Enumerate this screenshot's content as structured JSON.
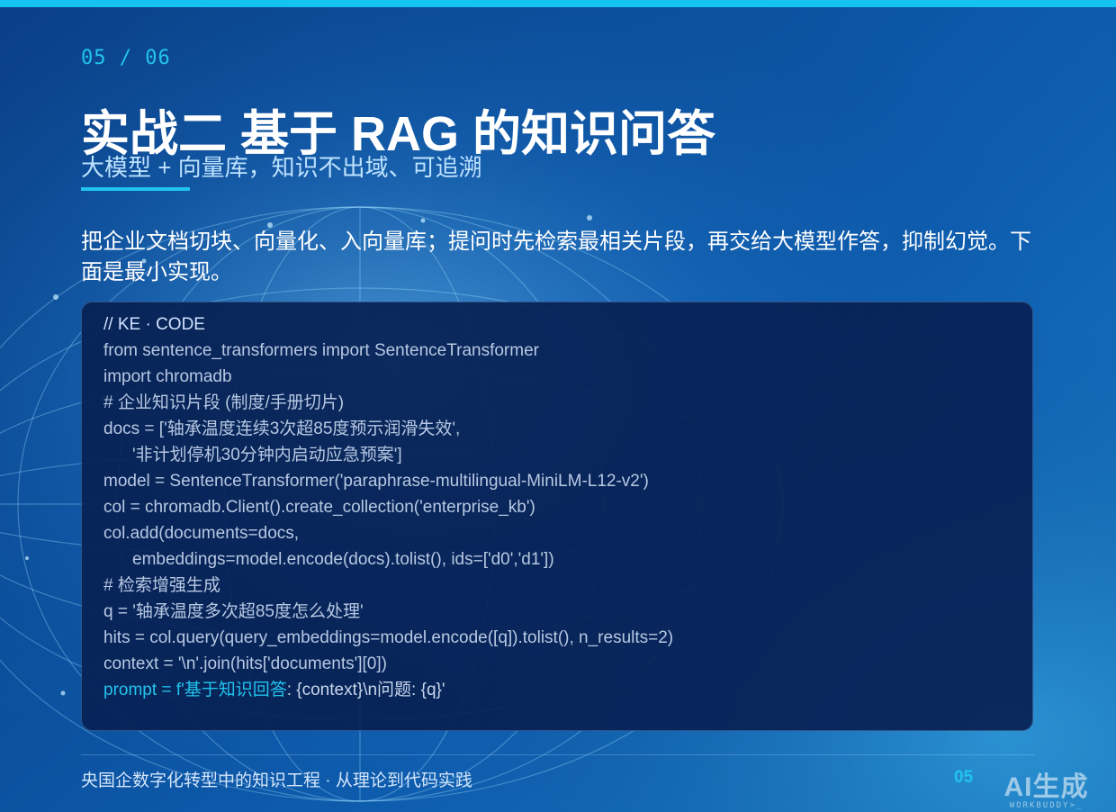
{
  "page_indicator": "05 / 06",
  "title": "实战二 基于 RAG 的知识问答",
  "subtitle": "大模型 + 向量库，知识不出域、可追溯",
  "lead": "把企业文档切块、向量化、入向量库；提问时先检索最相关片段，再交给大模型作答，抑制幻觉。下面是最小实现。",
  "code": {
    "label": "// KE · CODE",
    "lines": [
      "from sentence_transformers import SentenceTransformer",
      "import chromadb",
      "# 企业知识片段 (制度/手册切片)",
      "docs = ['轴承温度连续3次超85度预示润滑失效',",
      "'非计划停机30分钟内启动应急预案']",
      "model = SentenceTransformer('paraphrase-multilingual-MiniLM-L12-v2')",
      "col = chromadb.Client().create_collection('enterprise_kb')",
      "col.add(documents=docs,",
      "embeddings=model.encode(docs).tolist(), ids=['d0','d1'])",
      "# 检索增强生成",
      "q = '轴承温度多次超85度怎么处理'",
      "hits = col.query(query_embeddings=model.encode([q]).tolist(), n_results=2)",
      "context = '\\n'.join(hits['documents'][0])"
    ],
    "last_line_accent": "prompt = f'基于知识回答",
    "last_line_rest": ": {context}\\n问题: {q}'"
  },
  "footer": {
    "text": "央国企数字化转型中的知识工程  ·  从理论到代码实践",
    "page_number": "05"
  },
  "watermark": {
    "main": "AI生成",
    "sub": "WORKBUDDY>_"
  },
  "colors": {
    "accent": "#21c4ee",
    "background_dark": "#0a3f86",
    "code_card": "#082154"
  }
}
